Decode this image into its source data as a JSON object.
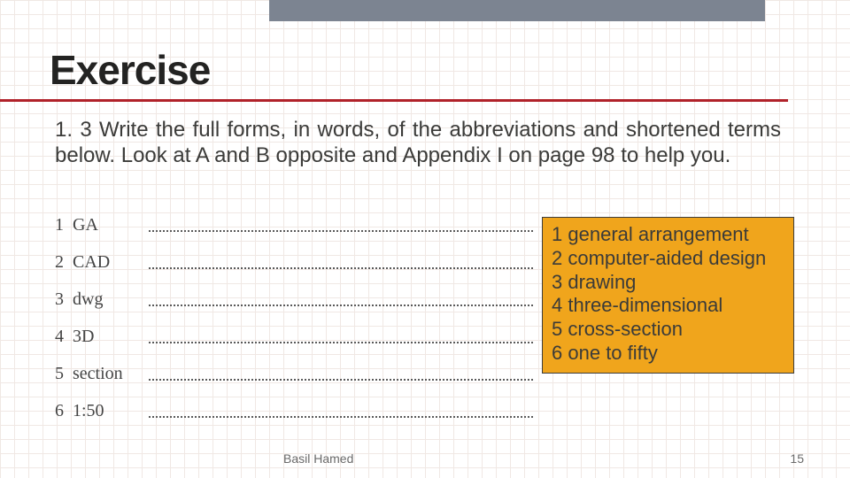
{
  "title": "Exercise",
  "prompt": "1. 3 Write the full forms, in words, of the abbreviations and shortened terms below. Look at A and B opposite and Appendix I on page 98 to help you.",
  "worksheet": [
    {
      "num": "1",
      "term": "GA"
    },
    {
      "num": "2",
      "term": "CAD"
    },
    {
      "num": "3",
      "term": "dwg"
    },
    {
      "num": "4",
      "term": "3D"
    },
    {
      "num": "5",
      "term": "section"
    },
    {
      "num": "6",
      "term": "1:50"
    }
  ],
  "answers": [
    {
      "num": "1",
      "text": "general arrangement"
    },
    {
      "num": "2",
      "text": "computer-aided design"
    },
    {
      "num": "3",
      "text": "drawing"
    },
    {
      "num": "4",
      "text": "three-dimensional"
    },
    {
      "num": "5",
      "text": "cross-section"
    },
    {
      "num": "6",
      "text": "one to fifty"
    }
  ],
  "footer": {
    "author": "Basil Hamed",
    "page": "15"
  }
}
